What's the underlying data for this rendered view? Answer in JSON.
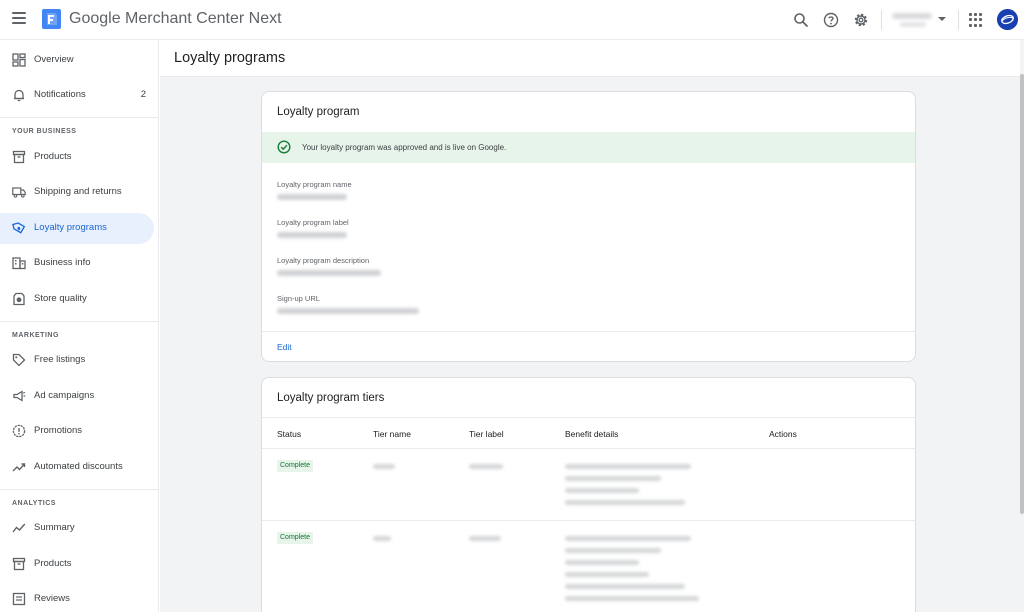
{
  "app": {
    "brand": "Google Merchant Center Next"
  },
  "topbar": {
    "icons": [
      "menu-icon",
      "search-icon",
      "help-icon",
      "settings-icon",
      "apps-icon"
    ]
  },
  "sidebar": {
    "items_top": [
      {
        "label": "Overview",
        "icon": "dashboard-icon"
      },
      {
        "label": "Notifications",
        "icon": "bell-icon",
        "count": "2"
      }
    ],
    "your_business_header": "YOUR BUSINESS",
    "your_business": [
      {
        "label": "Products",
        "icon": "archive-icon"
      },
      {
        "label": "Shipping and returns",
        "icon": "truck-icon"
      },
      {
        "label": "Loyalty programs",
        "icon": "loyalty-icon",
        "active": true
      },
      {
        "label": "Business info",
        "icon": "building-icon"
      },
      {
        "label": "Store quality",
        "icon": "store-quality-icon"
      }
    ],
    "marketing_header": "MARKETING",
    "marketing": [
      {
        "label": "Free listings",
        "icon": "tag-icon"
      },
      {
        "label": "Ad campaigns",
        "icon": "megaphone-icon"
      },
      {
        "label": "Promotions",
        "icon": "promo-icon"
      },
      {
        "label": "Automated discounts",
        "icon": "trend-icon"
      }
    ],
    "analytics_header": "ANALYTICS",
    "analytics": [
      {
        "label": "Summary",
        "icon": "chart-line-icon"
      },
      {
        "label": "Products",
        "icon": "archive-icon"
      },
      {
        "label": "Reviews",
        "icon": "reviews-icon"
      }
    ]
  },
  "page": {
    "title": "Loyalty programs"
  },
  "program_card": {
    "title": "Loyalty program",
    "banner": "Your loyalty program was approved and is live on Google.",
    "fields": [
      {
        "label": "Loyalty program name"
      },
      {
        "label": "Loyalty program label"
      },
      {
        "label": "Loyalty program description"
      },
      {
        "label": "Sign-up URL"
      }
    ],
    "edit_label": "Edit"
  },
  "tiers_card": {
    "title": "Loyalty program tiers",
    "columns": [
      "Status",
      "Tier name",
      "Tier label",
      "Benefit details",
      "Actions"
    ],
    "rows": [
      {
        "status": "Complete"
      },
      {
        "status": "Complete"
      }
    ]
  },
  "colors": {
    "accent": "#1967d2",
    "active_bg": "#e8f0fe",
    "success_bg": "#e6f4ea",
    "success_text": "#137333",
    "avatar": "#1a3fb0"
  }
}
